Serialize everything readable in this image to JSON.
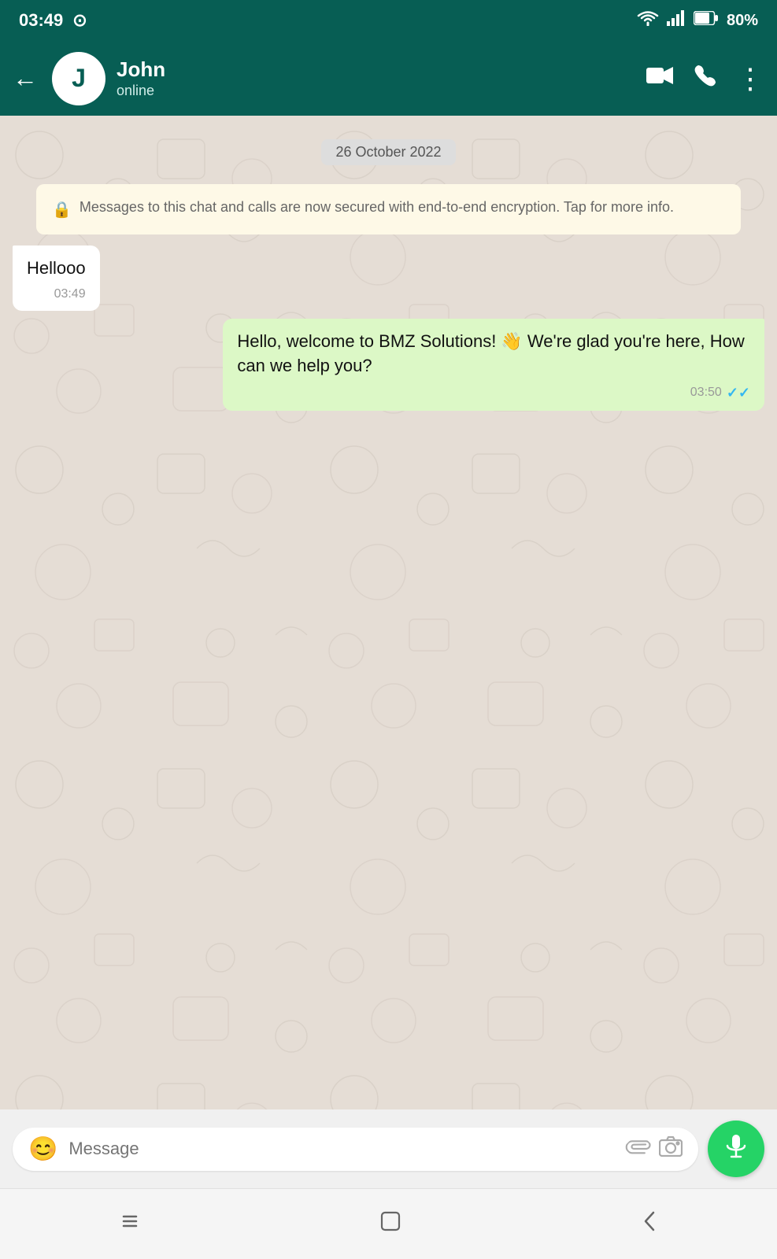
{
  "statusBar": {
    "time": "03:49",
    "battery": "80%",
    "whatsappIcon": "💬"
  },
  "header": {
    "backLabel": "←",
    "avatarLetter": "J",
    "contactName": "John",
    "contactStatus": "online",
    "videocallLabel": "📹",
    "callLabel": "📞",
    "moreLabel": "⋮"
  },
  "dateDivider": "26 October 2022",
  "encryptionNotice": "Messages to this chat and calls are now secured with end-to-end encryption. Tap for more info.",
  "messages": [
    {
      "type": "incoming",
      "text": "Hellooo",
      "time": "03:49",
      "ticks": null
    },
    {
      "type": "outgoing",
      "text": "Hello, welcome to BMZ Solutions! 👋 We're glad you're here, How can we help you?",
      "time": "03:50",
      "ticks": "✓✓"
    }
  ],
  "inputBar": {
    "placeholder": "Message",
    "emojiIcon": "😊",
    "micIcon": "🎤"
  },
  "navBar": {
    "recentIcon": "|||",
    "homeIcon": "□",
    "backIcon": "‹"
  }
}
